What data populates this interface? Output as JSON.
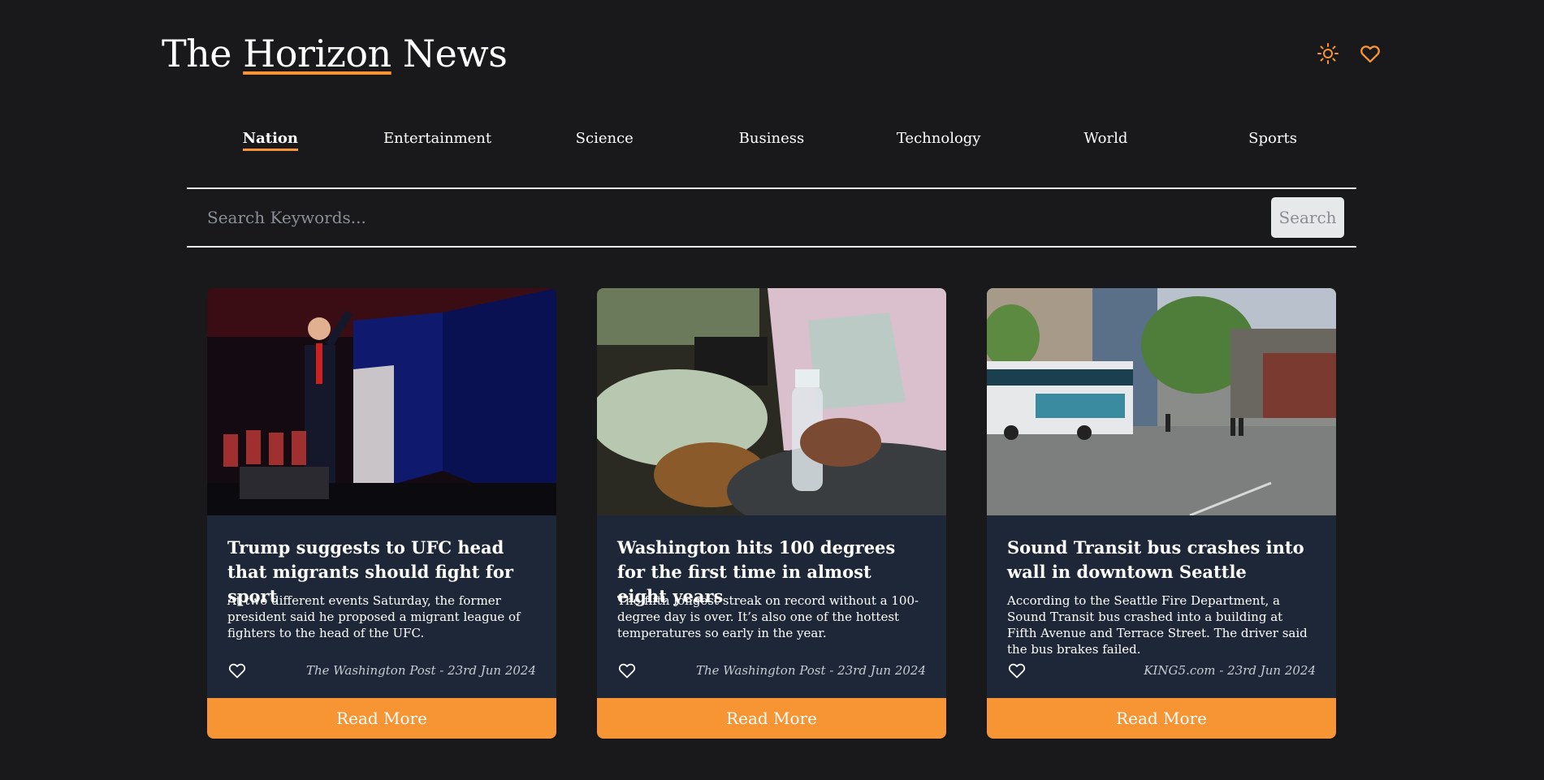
{
  "brand": {
    "prefix": "The ",
    "accent": "Horizon",
    "suffix": " News",
    "accent_color": "#f79433"
  },
  "header_icons": [
    {
      "name": "sun-icon",
      "label": "theme toggle"
    },
    {
      "name": "heart-icon",
      "label": "favorites"
    }
  ],
  "nav": {
    "items": [
      {
        "label": "Nation",
        "active": true
      },
      {
        "label": "Entertainment"
      },
      {
        "label": "Science"
      },
      {
        "label": "Business"
      },
      {
        "label": "Technology"
      },
      {
        "label": "World"
      },
      {
        "label": "Sports"
      }
    ]
  },
  "search": {
    "placeholder": "Search Keywords...",
    "value": "",
    "button_label": "Search"
  },
  "articles": [
    {
      "title": "Trump suggests to UFC head that migrants should fight for sport",
      "description": "At two different events Saturday, the former president said he proposed a migrant league of fighters to the head of the UFC.",
      "source_line": "The Washington Post - 23rd Jun 2024",
      "read_more": "Read More",
      "image": "man-at-podium-with-flags"
    },
    {
      "title": "Washington hits 100 degrees for the first time in almost eight years",
      "description": "The fifth longest streak on record without a 100-degree day is over. It’s also one of the hottest temperatures so early in the year.",
      "source_line": "The Washington Post - 23rd Jun 2024",
      "read_more": "Read More",
      "image": "person-holding-water-bottle"
    },
    {
      "title": "Sound Transit bus crashes into wall in downtown Seattle",
      "description": "According to the Seattle Fire Department, a Sound Transit bus crashed into a building at Fifth Avenue and Terrace Street. The driver said the bus brakes failed.",
      "source_line": "KING5.com - 23rd Jun 2024",
      "read_more": "Read More",
      "image": "bus-crashed-into-wall"
    }
  ],
  "colors": {
    "background": "#19191b",
    "card": "#1e2738",
    "accent": "#f79433"
  }
}
